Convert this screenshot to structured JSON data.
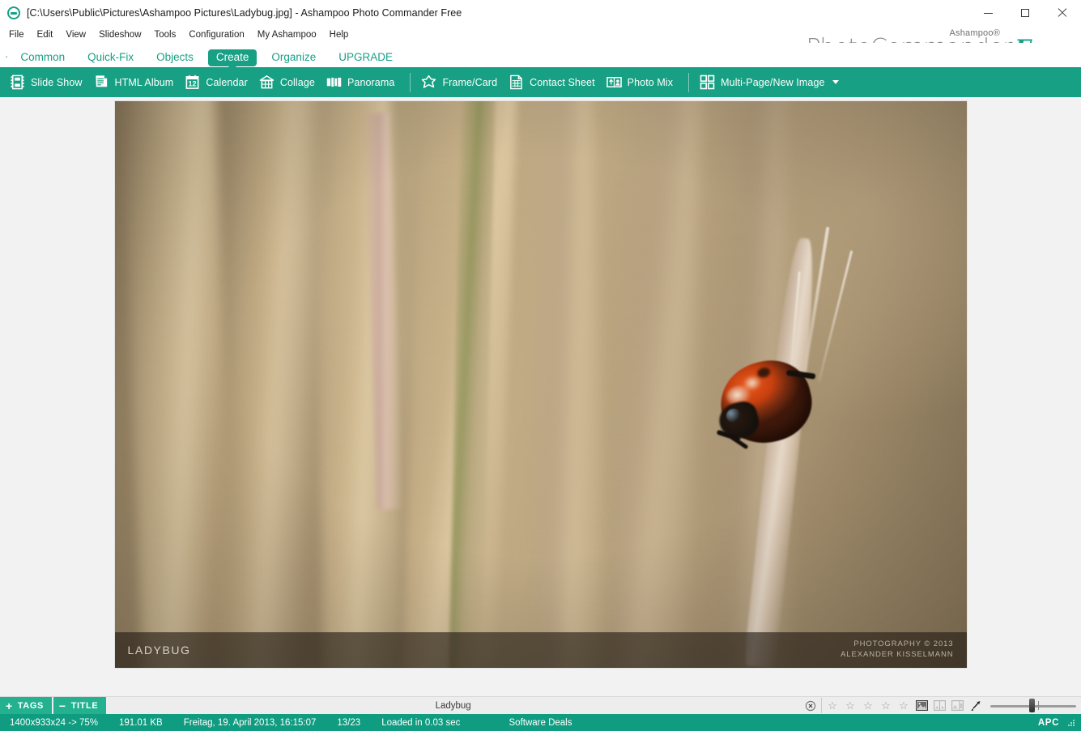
{
  "window": {
    "title": "[C:\\Users\\Public\\Pictures\\Ashampoo Pictures\\Ladybug.jpg] - Ashampoo Photo Commander Free",
    "app_icon": "ashampoo-logo-icon",
    "controls": {
      "minimize": "minimize-icon",
      "maximize": "maximize-icon",
      "close": "close-icon"
    }
  },
  "menubar": {
    "items": [
      {
        "label": "File"
      },
      {
        "label": "Edit"
      },
      {
        "label": "View"
      },
      {
        "label": "Slideshow"
      },
      {
        "label": "Tools"
      },
      {
        "label": "Configuration"
      },
      {
        "label": "My Ashampoo"
      },
      {
        "label": "Help"
      }
    ]
  },
  "brand": {
    "superscript": "Ashampoo®",
    "product": "PhotoCommander",
    "edition": "Free",
    "accent_color": "#18a085",
    "product_color": "#8c8c8c"
  },
  "tabs": {
    "items": [
      {
        "label": "Common",
        "active": false
      },
      {
        "label": "Quick-Fix",
        "active": false
      },
      {
        "label": "Objects",
        "active": false
      },
      {
        "label": "Create",
        "active": true
      },
      {
        "label": "Organize",
        "active": false
      },
      {
        "label": "UPGRADE",
        "active": false
      }
    ]
  },
  "toolbar": {
    "background_color": "#17a083",
    "items": [
      {
        "label": "Slide Show",
        "icon": "film-strip-icon"
      },
      {
        "label": "HTML Album",
        "icon": "document-pages-icon"
      },
      {
        "label": "Calendar",
        "icon": "calendar-icon",
        "icon_text": "12"
      },
      {
        "label": "Collage",
        "icon": "collage-grid-icon"
      },
      {
        "label": "Panorama",
        "icon": "panorama-bars-icon"
      },
      {
        "label": "Frame/Card",
        "icon": "frame-card-star-icon"
      },
      {
        "label": "Contact Sheet",
        "icon": "contact-sheet-icon"
      },
      {
        "label": "Photo Mix",
        "icon": "photo-mix-icon"
      },
      {
        "label": "Multi-Page/New Image",
        "icon": "multi-page-icon",
        "has_dropdown": true
      }
    ]
  },
  "photo": {
    "caption": "LADYBUG",
    "credit_line1": "PHOTOGRAPHY © 2013",
    "credit_line2": "ALEXANDER KISSELMANN",
    "canvas_background": "#f2f2f2"
  },
  "tagbar": {
    "tags_sign": "+",
    "tags_label": "TAGS",
    "title_sign": "−",
    "title_label": "TITLE",
    "title_value": "Ladybug",
    "clear_icon": "clear-circle-x-icon",
    "rating": {
      "value": 0,
      "max": 5,
      "star_empty": "☆",
      "star_full": "★"
    },
    "view_icons": [
      {
        "name": "single-image-view-icon",
        "enabled": true
      },
      {
        "name": "split-view-vertical-icon",
        "enabled": false
      },
      {
        "name": "split-view-horizontal-icon",
        "enabled": false
      }
    ],
    "fit_icon": "fit-to-window-icon",
    "zoom_slider": {
      "value": 45,
      "min": 0,
      "max": 100
    }
  },
  "statusbar": {
    "background_color": "#0f9c80",
    "dimensions": "1400x933x24 -> 75%",
    "filesize": "191.01 KB",
    "datetime": "Freitag, 19. April 2013, 16:15:07",
    "position": "13/23",
    "loadtime": "Loaded in 0.03 sec",
    "deals": "Software Deals",
    "apc": "APC",
    "grip": "resize-grip-icon"
  }
}
